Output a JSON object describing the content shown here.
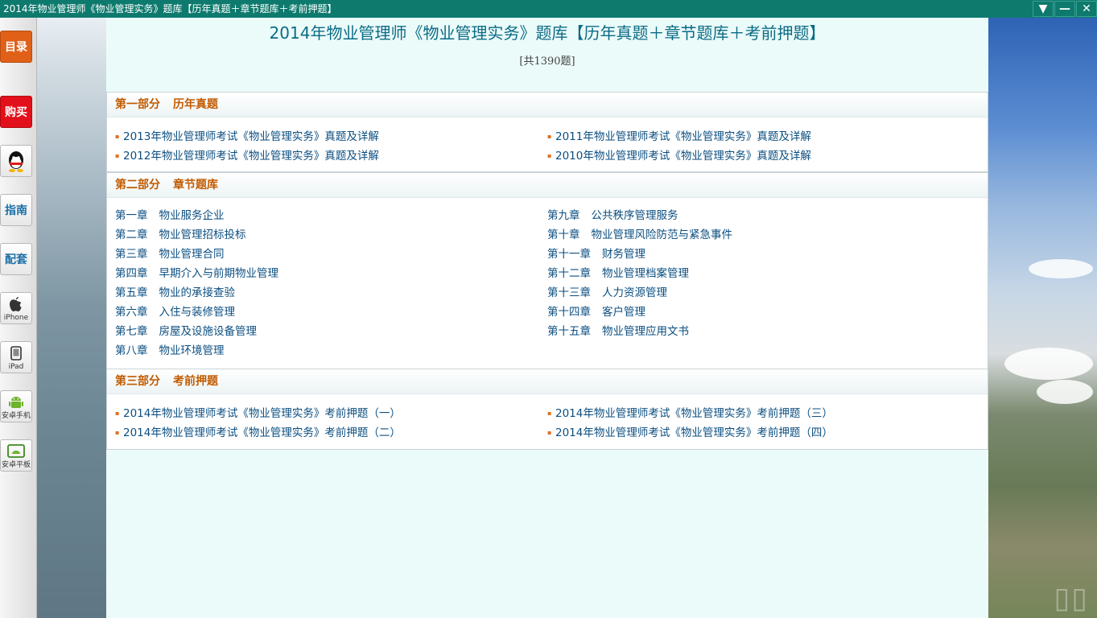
{
  "window": {
    "title": "2014年物业管理师《物业管理实务》题库【历年真题＋章节题库＋考前押题】",
    "buttons": {
      "dropdown": "▼",
      "minimize": "—",
      "close": "✕"
    }
  },
  "sidebar": {
    "catalog": "目录",
    "buy": "购买",
    "guide": "指南",
    "bundle": "配套",
    "iphone": "iPhone",
    "ipad": "iPad",
    "android_phone": "安卓手机",
    "android_tablet": "安卓平板"
  },
  "header": {
    "title": "2014年物业管理师《物业管理实务》题库【历年真题＋章节题库＋考前押题】",
    "count": "[共1390题]"
  },
  "sections": [
    {
      "part": "第一部分",
      "name": "历年真题",
      "items": [
        "2013年物业管理师考试《物业管理实务》真题及详解",
        "2012年物业管理师考试《物业管理实务》真题及详解",
        "2011年物业管理师考试《物业管理实务》真题及详解",
        "2010年物业管理师考试《物业管理实务》真题及详解"
      ]
    },
    {
      "part": "第二部分",
      "name": "章节题库",
      "chapters": [
        {
          "num": "第一章",
          "title": "物业服务企业"
        },
        {
          "num": "第二章",
          "title": "物业管理招标投标"
        },
        {
          "num": "第三章",
          "title": "物业管理合同"
        },
        {
          "num": "第四章",
          "title": "早期介入与前期物业管理"
        },
        {
          "num": "第五章",
          "title": "物业的承接查验"
        },
        {
          "num": "第六章",
          "title": "入住与装修管理"
        },
        {
          "num": "第七章",
          "title": "房屋及设施设备管理"
        },
        {
          "num": "第八章",
          "title": "物业环境管理"
        },
        {
          "num": "第九章",
          "title": "公共秩序管理服务"
        },
        {
          "num": "第十章",
          "title": "物业管理风险防范与紧急事件"
        },
        {
          "num": "第十一章",
          "title": "财务管理"
        },
        {
          "num": "第十二章",
          "title": "物业管理档案管理"
        },
        {
          "num": "第十三章",
          "title": "人力资源管理"
        },
        {
          "num": "第十四章",
          "title": "客户管理"
        },
        {
          "num": "第十五章",
          "title": "物业管理应用文书"
        }
      ]
    },
    {
      "part": "第三部分",
      "name": "考前押题",
      "items": [
        "2014年物业管理师考试《物业管理实务》考前押题（一）",
        "2014年物业管理师考试《物业管理实务》考前押题（二）",
        "2014年物业管理师考试《物业管理实务》考前押题（三）",
        "2014年物业管理师考试《物业管理实务》考前押题（四）"
      ]
    }
  ]
}
